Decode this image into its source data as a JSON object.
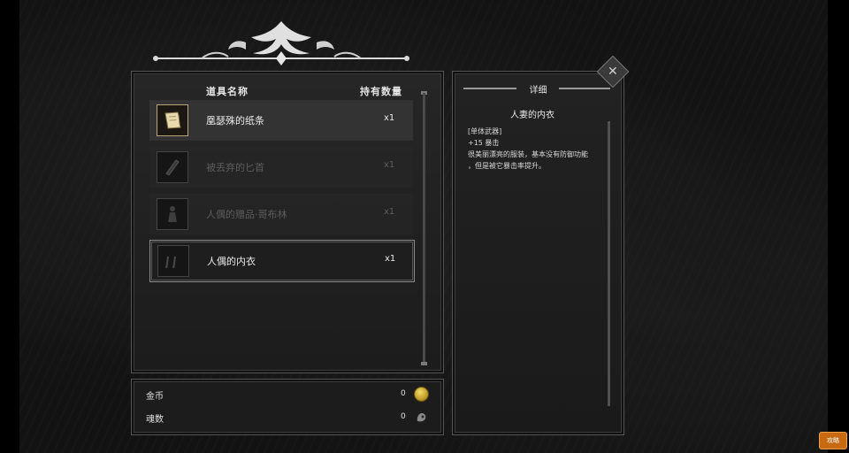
{
  "inventory": {
    "header_name": "道具名称",
    "header_qty": "持有数量",
    "items": [
      {
        "name": "凰瑟殊的纸条",
        "qty": "x1",
        "icon": "paper-scroll-icon",
        "state": "active"
      },
      {
        "name": "被丢弃的匕首",
        "qty": "x1",
        "icon": "dagger-icon",
        "state": "dim"
      },
      {
        "name": "人偶的赠品·哥布林",
        "qty": "x1",
        "icon": "figurine-icon",
        "state": "dim"
      },
      {
        "name": "人偶的内衣",
        "qty": "x1",
        "icon": "underwear-icon",
        "state": "selected"
      }
    ]
  },
  "currency": {
    "gold_label": "金币",
    "gold_value": "0",
    "soul_label": "魂数",
    "soul_value": "0"
  },
  "detail": {
    "title": "详细",
    "item_name": "人妻的内衣",
    "tag": "[单体武器]",
    "stat": "+15 暴击",
    "desc_line1": "很美丽漂亮的服装，基本没有防御功能",
    "desc_line2": "，但是被它暴击率提升。"
  },
  "corner_button_label": "攻略",
  "colors": {
    "accent_gold": "#b7a27a",
    "coin": "#e0c24a",
    "corner_button": "#c76a12"
  }
}
